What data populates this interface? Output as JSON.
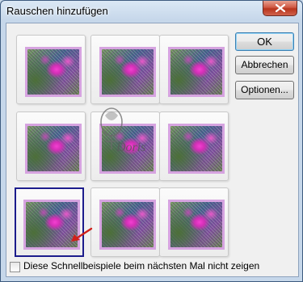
{
  "dialog": {
    "title": "Rauschen hinzufügen",
    "close_icon": "close-icon"
  },
  "buttons": {
    "ok": "OK",
    "cancel": "Abbrechen",
    "options": "Optionen..."
  },
  "previews": {
    "rows": 3,
    "columns": 3,
    "selected": {
      "row": 3,
      "column": 1
    }
  },
  "watermark": {
    "text": "Doris"
  },
  "checkbox": {
    "label": "Diese Schnellbeispiele beim nächsten Mal nicht zeigen",
    "checked": false
  },
  "colors": {
    "title_bar": "#c6d7ea",
    "close_button": "#c7412b",
    "selection_border": "#1c1c8c",
    "arrow": "#d0201a",
    "thumbnail_frame": "#d6a3e0"
  }
}
